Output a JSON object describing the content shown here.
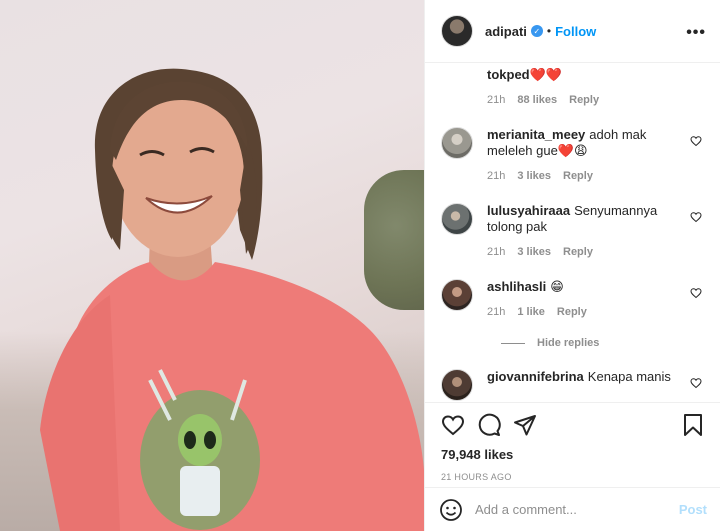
{
  "post": {
    "username": "adipati",
    "follow_label": "Follow",
    "separator": "•",
    "more_label": "•••",
    "verified": true
  },
  "comments": [
    {
      "user": "",
      "text": "tokped❤️❤️",
      "time": "21h",
      "likes": "88 likes",
      "reply": "Reply"
    },
    {
      "user": "merianita_meey",
      "text": "adoh mak meleleh gue❤️😩",
      "time": "21h",
      "likes": "3 likes",
      "reply": "Reply"
    },
    {
      "user": "lulusyahiraaa",
      "text": "Senyumannya tolong pak",
      "time": "21h",
      "likes": "3 likes",
      "reply": "Reply"
    },
    {
      "user": "ashlihasli",
      "text": "😁",
      "time": "21h",
      "likes": "1 like",
      "reply": "Reply"
    },
    {
      "user": "giovannifebrina",
      "text": "Kenapa manis",
      "time": "",
      "likes": "",
      "reply": ""
    }
  ],
  "hide_replies_label": "Hide replies",
  "likes_count": "79,948 likes",
  "timestamp": "21 HOURS AGO",
  "add_comment": {
    "placeholder": "Add a comment...",
    "post_label": "Post"
  },
  "colors": {
    "accent": "#0095f6",
    "post_disabled": "#b2dffc",
    "muted": "#8e8e8e",
    "text": "#262626"
  },
  "icons": [
    "heart-icon",
    "comment-icon",
    "share-icon",
    "save-icon",
    "emoji-icon",
    "more-icon",
    "verified-icon"
  ]
}
